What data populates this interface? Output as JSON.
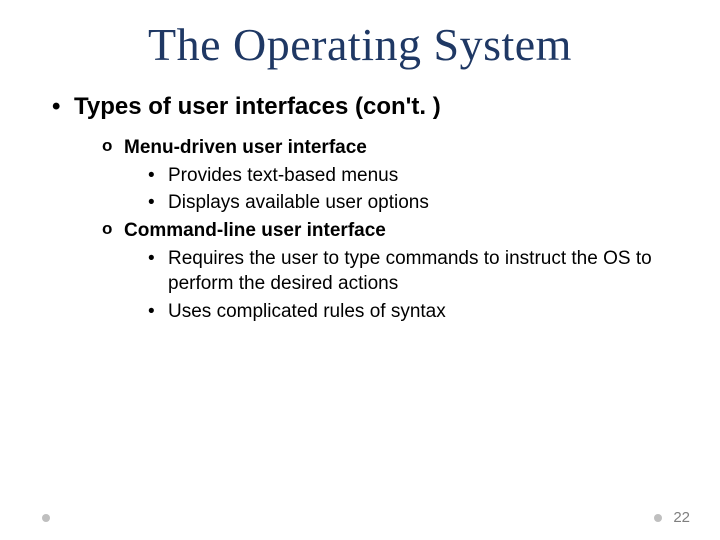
{
  "title": "The Operating System",
  "heading": "Types of user interfaces (con't. )",
  "items": [
    {
      "label": "Menu-driven user interface",
      "sub": [
        "Provides text-based menus",
        "Displays available user options"
      ]
    },
    {
      "label": "Command-line user interface",
      "sub": [
        "Requires the user to type commands to instruct the OS to perform the desired actions",
        "Uses complicated rules of syntax"
      ]
    }
  ],
  "page_number": "22"
}
